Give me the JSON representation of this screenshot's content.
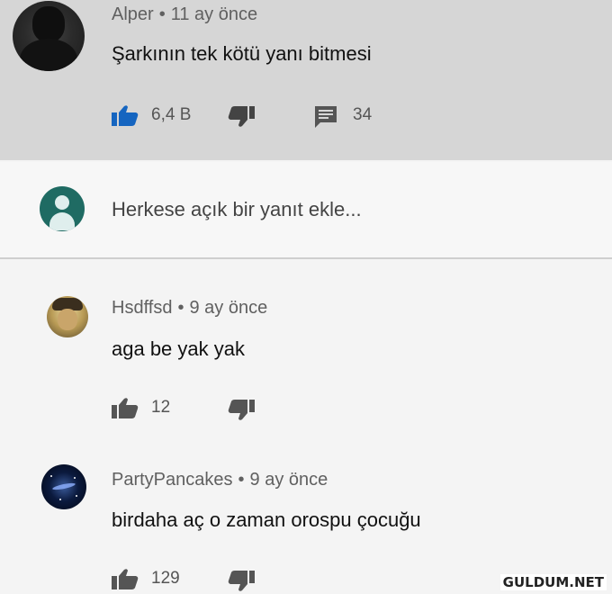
{
  "main_comment": {
    "author": "Alper",
    "time": "11 ay önce",
    "text": "Şarkının tek kötü yanı bitmesi",
    "likes": "6,4 B",
    "replies": "34",
    "like_color": "#1565c0"
  },
  "reply_box": {
    "placeholder": "Herkese açık bir yanıt ekle..."
  },
  "replies": [
    {
      "author": "Hsdffsd",
      "time": "9 ay önce",
      "text": "aga be yak yak",
      "likes": "12"
    },
    {
      "author": "PartyPancakes",
      "time": "9 ay önce",
      "text": "birdaha aç o zaman orospu çocuğu",
      "likes": "129"
    }
  ],
  "watermark": "GULDUM.NET",
  "separator": "•"
}
